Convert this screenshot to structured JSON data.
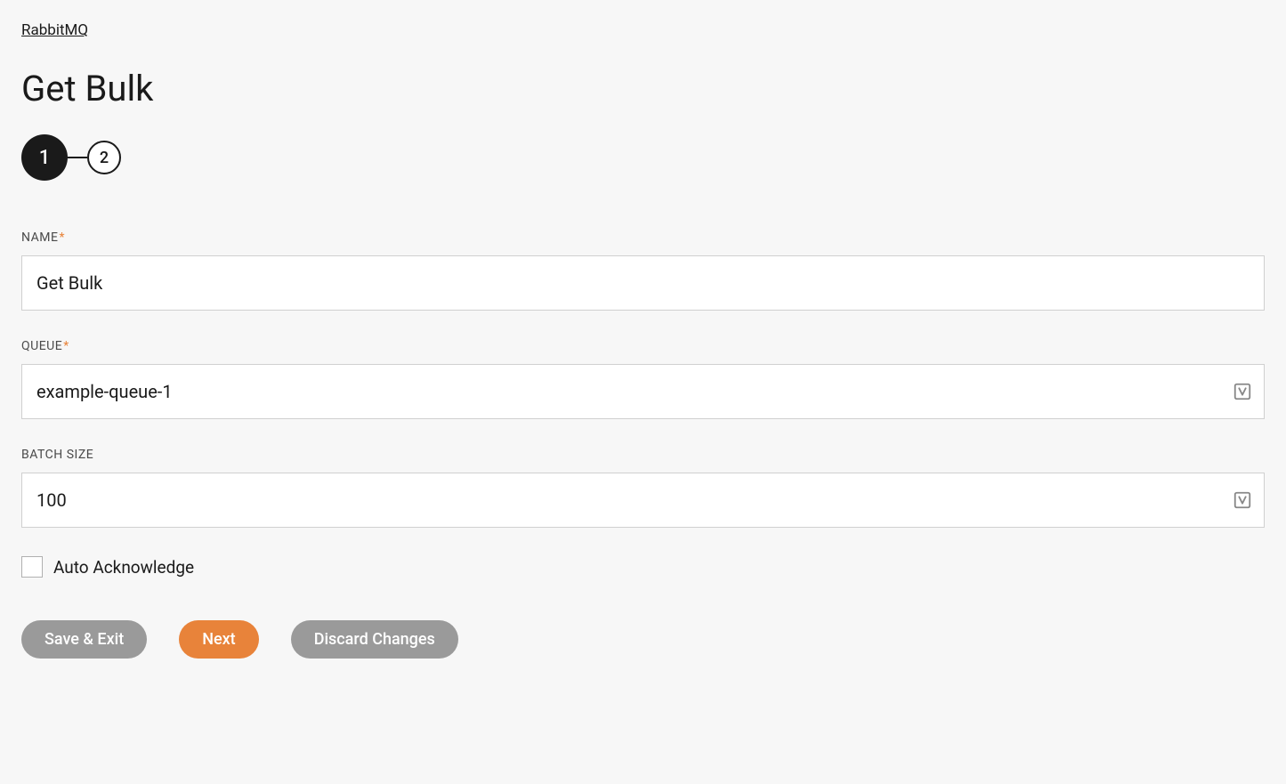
{
  "breadcrumb": "RabbitMQ",
  "pageTitle": "Get Bulk",
  "stepper": {
    "step1": "1",
    "step2": "2"
  },
  "form": {
    "nameLabel": "NAME",
    "nameValue": "Get Bulk",
    "queueLabel": "QUEUE",
    "queueValue": "example-queue-1",
    "batchSizeLabel": "BATCH SIZE",
    "batchSizeValue": "100",
    "autoAckLabel": "Auto Acknowledge",
    "requiredMark": "*"
  },
  "buttons": {
    "saveExit": "Save & Exit",
    "next": "Next",
    "discard": "Discard Changes"
  }
}
